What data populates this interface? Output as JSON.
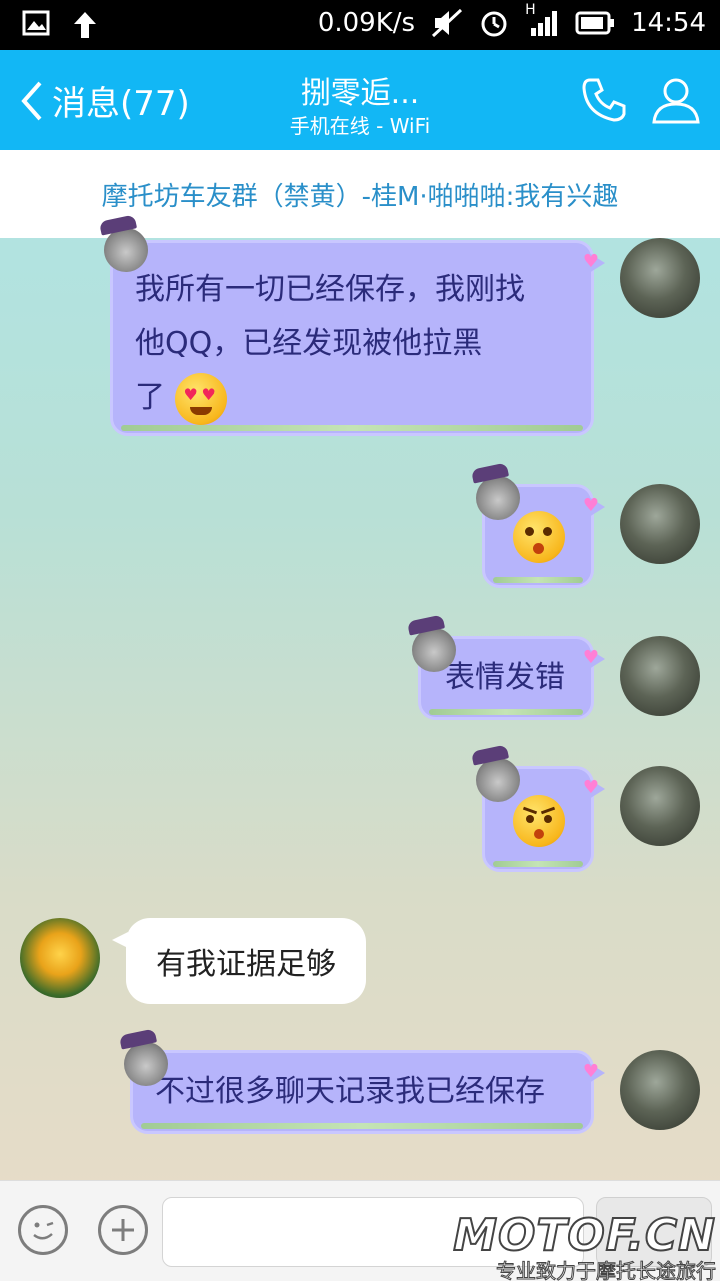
{
  "status_bar": {
    "speed": "0.09K/s",
    "network_label": "H",
    "time": "14:54"
  },
  "header": {
    "back_label": "消息(77)",
    "title": "捌零逅...",
    "subtitle": "手机在线 - WiFi"
  },
  "notice": {
    "text": "摩托坊车友群（禁黄）-桂M·啪啪啪:我有兴趣"
  },
  "messages": [
    {
      "side": "right",
      "line1": "我所有一切已经保存，我刚找",
      "line2": "他QQ，已经发现被他拉黑",
      "line3": "了",
      "emoji": "heart-eyes-emoji"
    },
    {
      "side": "right",
      "emoji": "shocked-emoji"
    },
    {
      "side": "right",
      "text": "表情发错"
    },
    {
      "side": "right",
      "emoji": "angry-emoji"
    },
    {
      "side": "left",
      "text": "有我证据足够"
    },
    {
      "side": "right",
      "text": "不过很多聊天记录我已经保存"
    }
  ],
  "watermark": {
    "brand": "MOTOF.CN",
    "slogan": "专业致力于摩托长途旅行"
  },
  "colors": {
    "header": "#12b7f5",
    "bubble": "#b6b4fb",
    "bubble_text": "#2b2b7a"
  }
}
